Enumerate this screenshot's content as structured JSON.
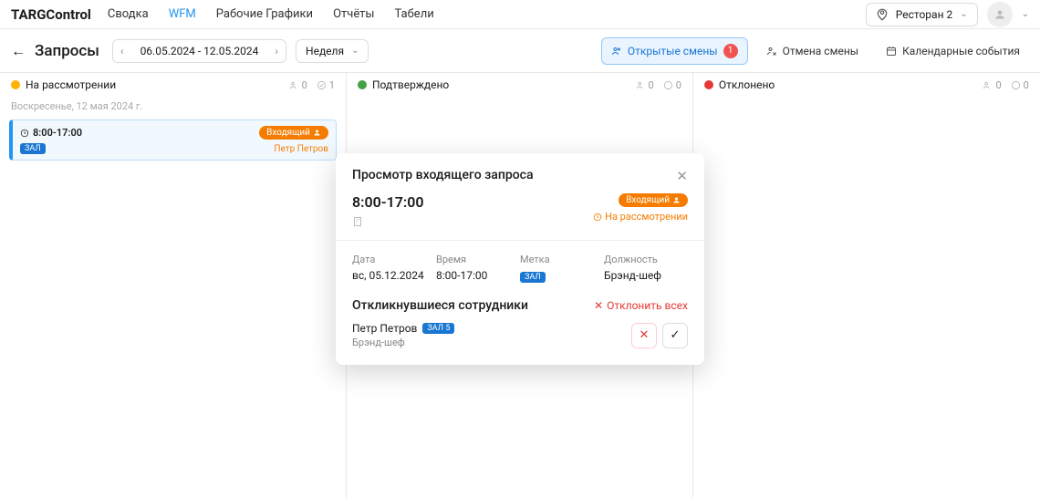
{
  "brand": "TARGControl",
  "nav": [
    "Сводка",
    "WFM",
    "Рабочие Графики",
    "Отчёты",
    "Табели"
  ],
  "location": "Ресторан 2",
  "toolbar": {
    "title": "Запросы",
    "date_range": "06.05.2024 - 12.05.2024",
    "period": "Неделя",
    "open_shifts_label": "Открытые смены",
    "open_shifts_count": "1",
    "cancel_shift_label": "Отмена смены",
    "calendar_label": "Календарные события"
  },
  "columns": {
    "pending": {
      "label": "На рассмотрении",
      "people": "0",
      "merge": "1"
    },
    "approved": {
      "label": "Подтверждено",
      "people": "0",
      "merge": "0"
    },
    "rejected": {
      "label": "Отклонено",
      "people": "0",
      "merge": "0"
    }
  },
  "sub_date": "Воскресенье, 12 мая 2024 г.",
  "card": {
    "time": "8:00-17:00",
    "badge": "Входящий",
    "tag": "ЗАЛ",
    "name": "Петр Петров"
  },
  "modal": {
    "title": "Просмотр входящего запроса",
    "time": "8:00-17:00",
    "badge": "Входящий",
    "status": "На рассмотрении",
    "date_label": "Дата",
    "date_val": "вс, 05.12.2024",
    "time_label": "Время",
    "time_val": "8:00-17:00",
    "tag_label": "Метка",
    "tag_val": "ЗАЛ",
    "role_label": "Должность",
    "role_val": "Брэнд-шеф",
    "resp_title": "Откликнувшиеся сотрудники",
    "decline_all": "Отклонить всех",
    "resp_name": "Петр Петров",
    "resp_tag": "ЗАЛ 5",
    "resp_role": "Брэнд-шеф"
  }
}
